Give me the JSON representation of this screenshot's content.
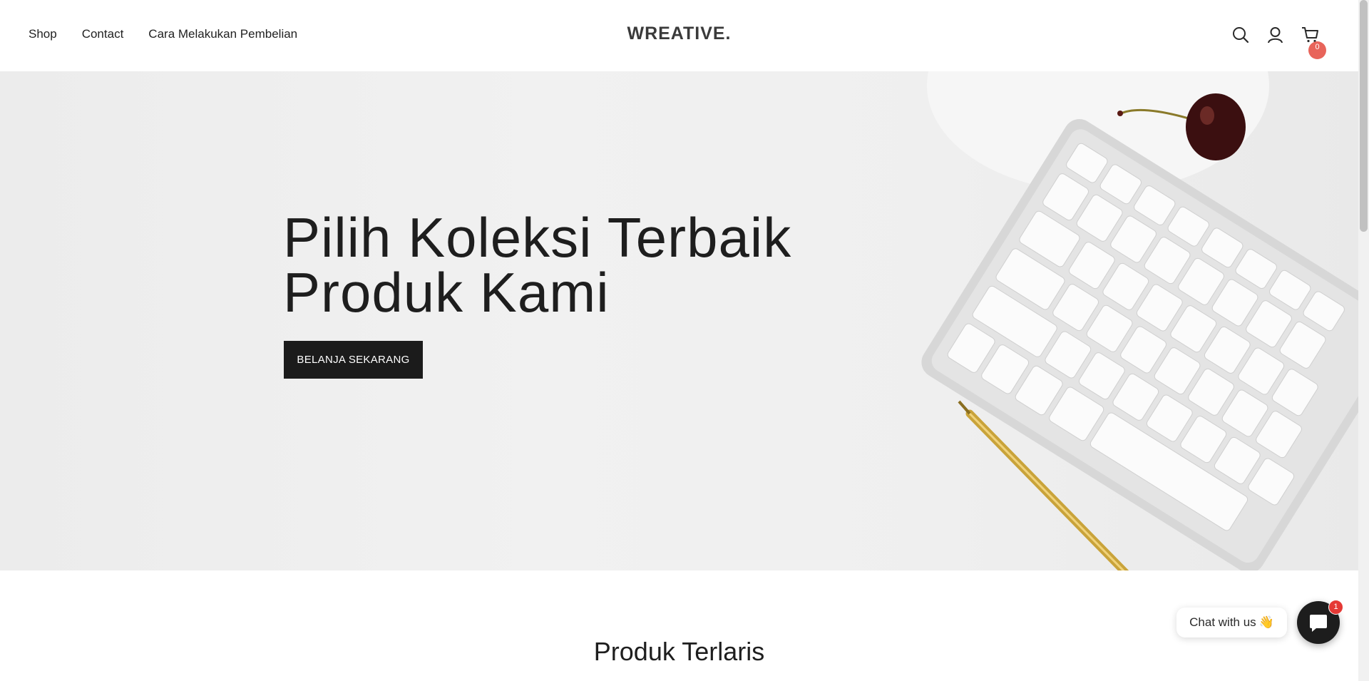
{
  "header": {
    "nav": [
      {
        "label": "Shop"
      },
      {
        "label": "Contact"
      },
      {
        "label": "Cara Melakukan Pembelian"
      }
    ],
    "logo": "WREATIVE.",
    "cart_count": "0",
    "icons": [
      "search-icon",
      "user-icon",
      "cart-icon"
    ]
  },
  "hero": {
    "title_line1": "Pilih Koleksi Terbaik",
    "title_line2": "Produk Kami",
    "button_label": "BELANJA SEKARANG"
  },
  "section": {
    "title": "Produk Terlaris"
  },
  "chat": {
    "label": "Chat with us",
    "emoji": "👋",
    "unread": "1"
  },
  "colors": {
    "accent_badge": "#e8645a",
    "button_dark": "#1b1b1b"
  }
}
